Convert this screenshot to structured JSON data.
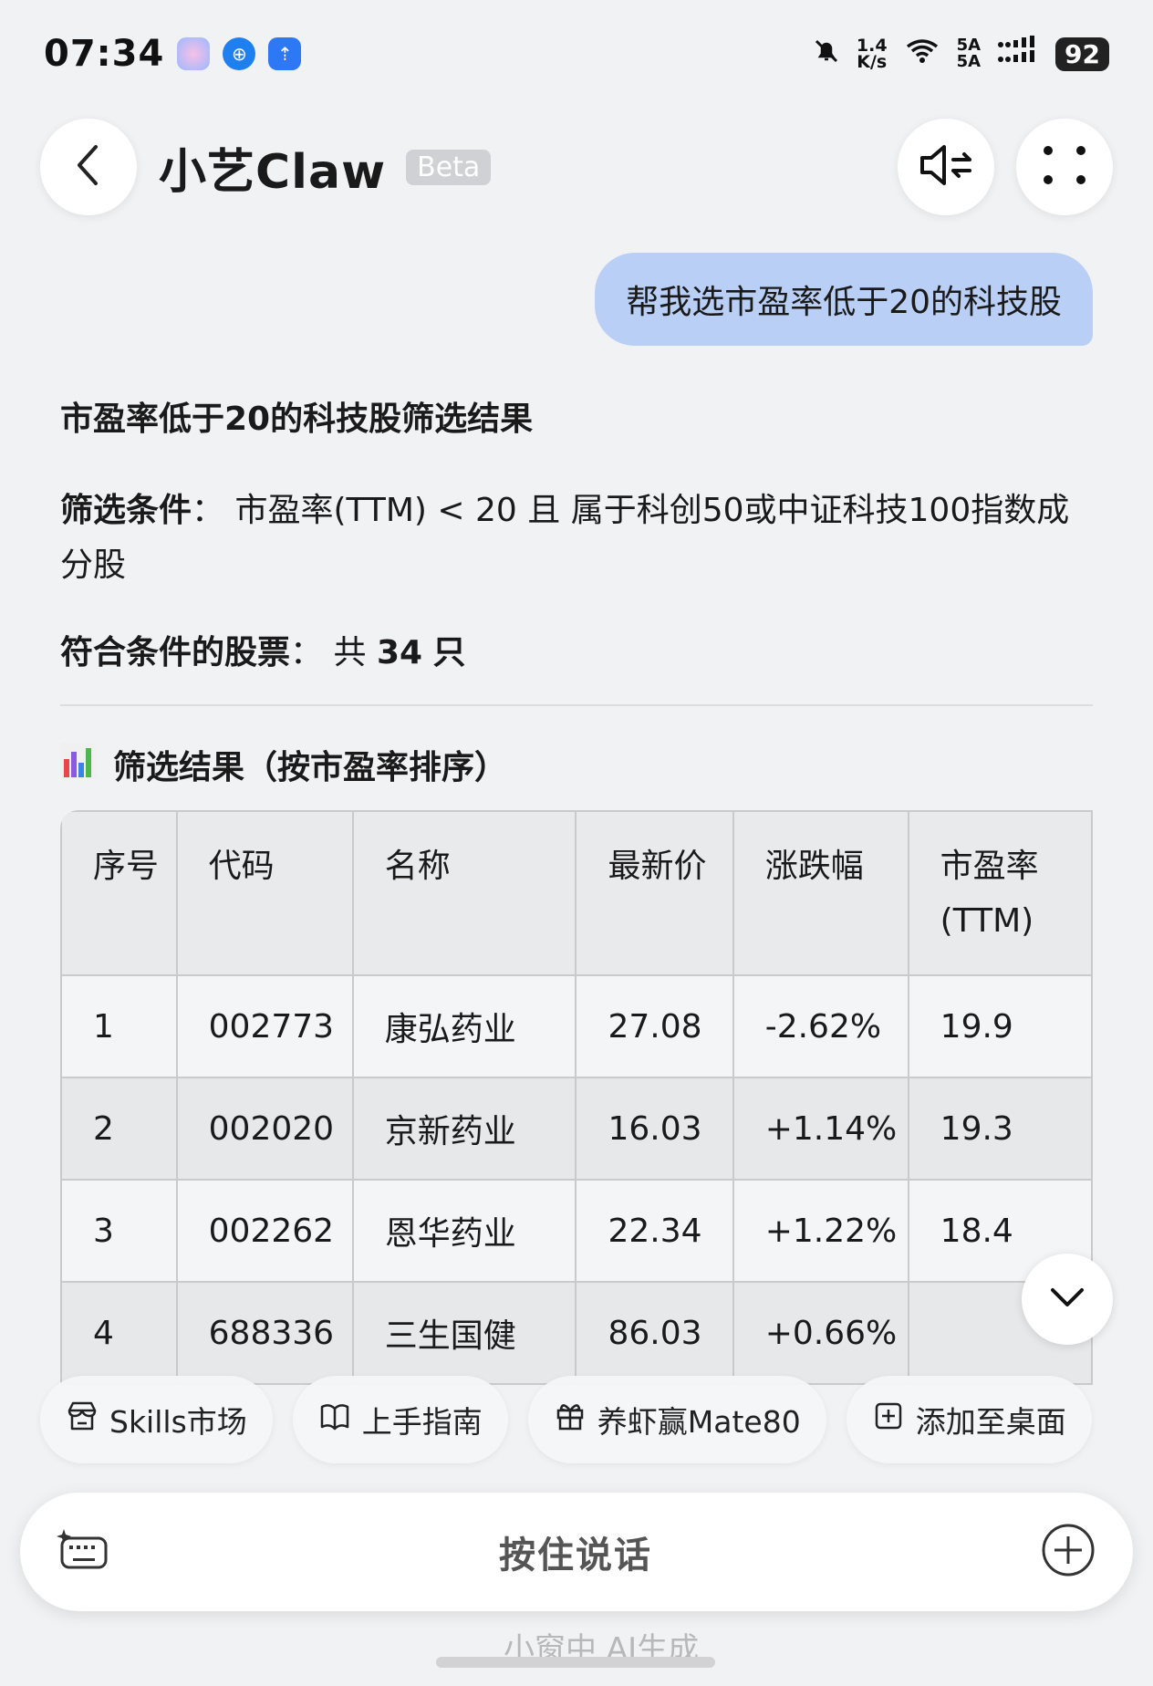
{
  "status_bar": {
    "time": "07:34",
    "net_speed_value": "1.4",
    "net_speed_unit": "K/s",
    "signal_label_1": "5A",
    "signal_label_2": "5A",
    "battery": "92"
  },
  "header": {
    "title": "小艺Claw",
    "badge": "Beta"
  },
  "chat": {
    "user_message": "帮我选市盈率低于20的科技股",
    "heading": "市盈率低于20的科技股筛选结果",
    "criteria_label": "筛选条件",
    "criteria_text": "市盈率(TTM) < 20 且 属于科创50或中证科技100指数成分股",
    "count_label": "符合条件的股票",
    "count_prefix": "共",
    "count_value": "34",
    "count_suffix": "只",
    "section_title": "筛选结果（按市盈率排序）"
  },
  "table": {
    "headers": [
      "序号",
      "代码",
      "名称",
      "最新价",
      "涨跌幅",
      "市盈率(TTM)"
    ],
    "rows": [
      [
        "1",
        "002773",
        "康弘药业",
        "27.08",
        "-2.62%",
        "19.9"
      ],
      [
        "2",
        "002020",
        "京新药业",
        "16.03",
        "+1.14%",
        "19.3"
      ],
      [
        "3",
        "002262",
        "恩华药业",
        "22.34",
        "+1.22%",
        "18.4"
      ],
      [
        "4",
        "688336",
        "三生国健",
        "86.03",
        "+0.66%",
        ""
      ]
    ]
  },
  "chips": {
    "skills": "Skills市场",
    "guide": "上手指南",
    "promo": "养虾赢Mate80",
    "add_desktop": "添加至桌面"
  },
  "input": {
    "hold_to_talk": "按住说话"
  },
  "watermark": "小窗中 AI生成"
}
